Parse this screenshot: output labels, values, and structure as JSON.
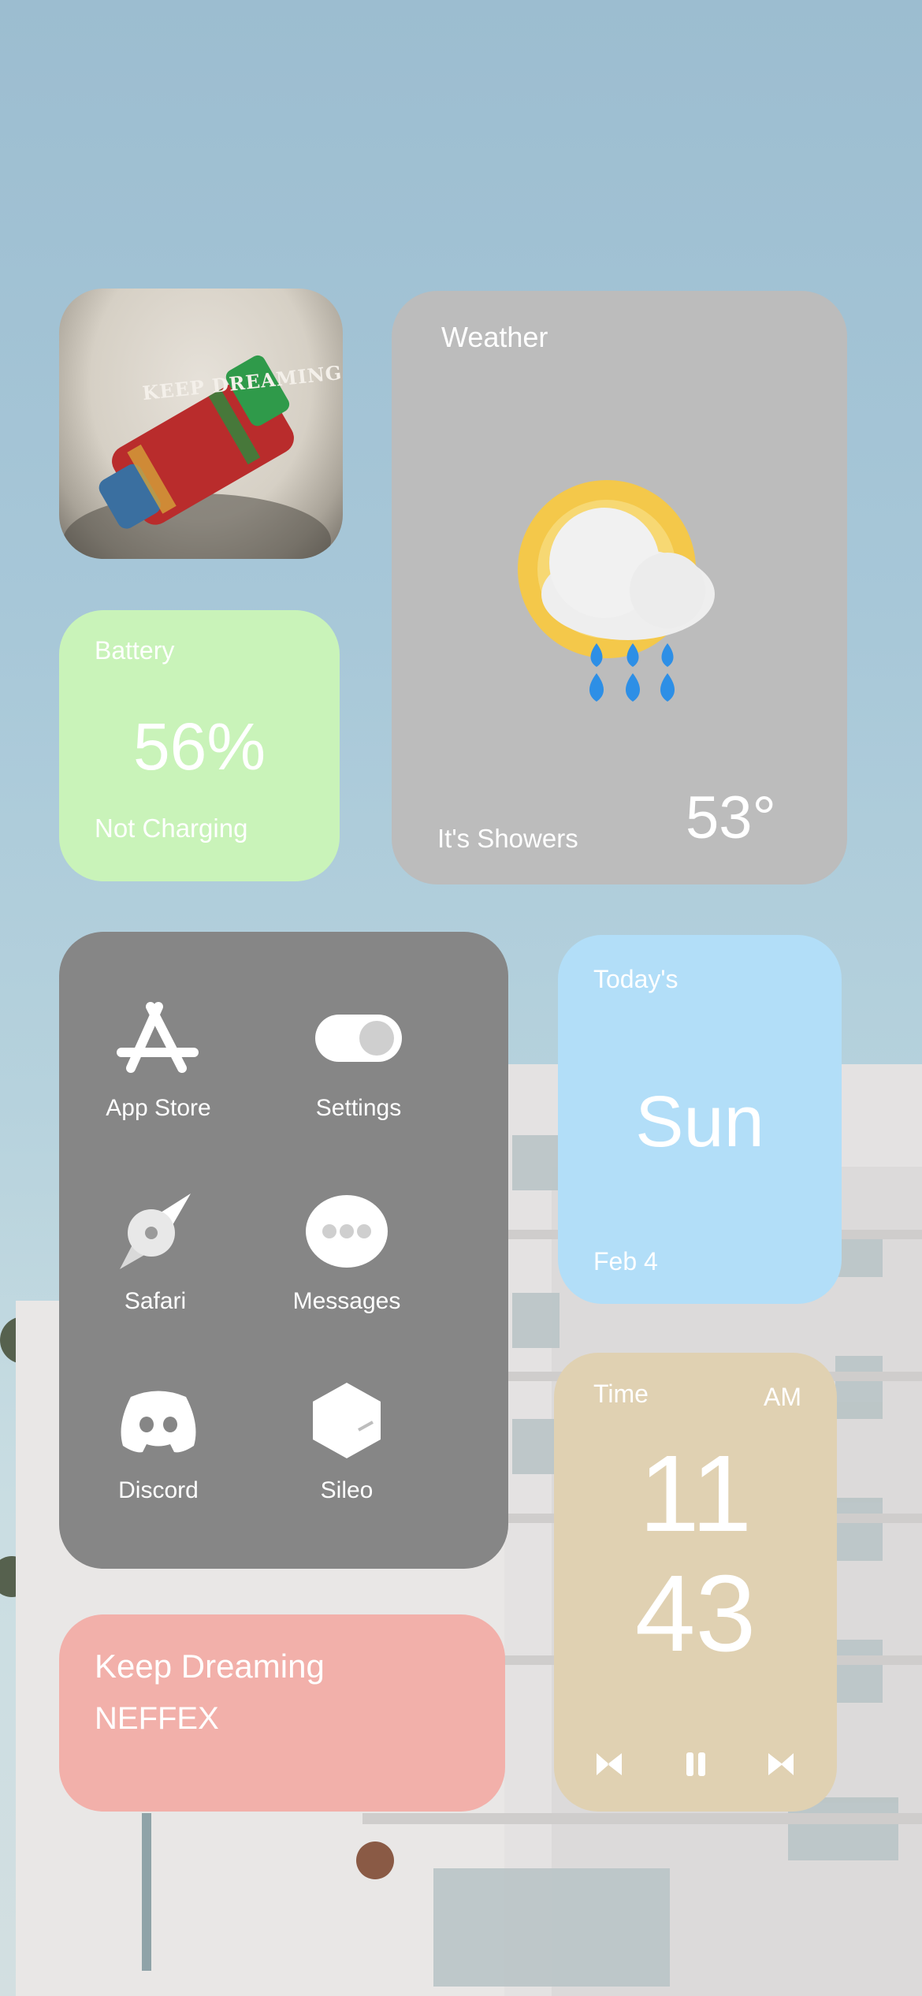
{
  "album": {
    "title": "KEEP DREAMING"
  },
  "weather": {
    "title": "Weather",
    "condition": "It's Showers",
    "temperature": "53°",
    "icon": "sun-cloud-rain-icon"
  },
  "battery": {
    "title": "Battery",
    "percent": "56%",
    "status": "Not Charging"
  },
  "apps": [
    {
      "label": "App Store",
      "icon": "app-store-icon"
    },
    {
      "label": "Settings",
      "icon": "toggle-icon"
    },
    {
      "label": "Safari",
      "icon": "compass-icon"
    },
    {
      "label": "Messages",
      "icon": "chat-bubble-icon"
    },
    {
      "label": "Discord",
      "icon": "discord-icon"
    },
    {
      "label": "Sileo",
      "icon": "cube-icon"
    }
  ],
  "date": {
    "title": "Today's",
    "day": "Sun",
    "date": "Feb 4"
  },
  "time": {
    "title": "Time",
    "ampm": "AM",
    "hour": "11",
    "minute": "43"
  },
  "music": {
    "song": "Keep Dreaming",
    "artist": "NEFFEX"
  },
  "colors": {
    "weather_bg": "#bcbcbc",
    "battery_bg": "#c9f3b9",
    "apps_bg": "#868686",
    "date_bg": "#b2def8",
    "time_bg": "#e0d1b2",
    "music_bg": "#f2b0aa"
  }
}
